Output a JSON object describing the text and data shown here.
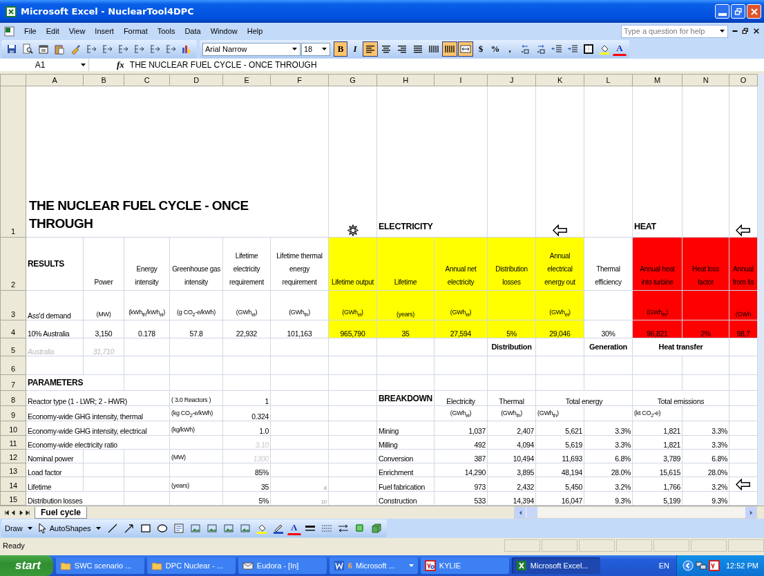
{
  "window": {
    "title": "Microsoft Excel - NuclearTool4DPC"
  },
  "menu": {
    "items": [
      "File",
      "Edit",
      "View",
      "Insert",
      "Format",
      "Tools",
      "Data",
      "Window",
      "Help"
    ],
    "help_search": {
      "placeholder": "Type a question for help"
    }
  },
  "toolbar": {
    "standard": [
      {
        "kind": "save"
      },
      {
        "kind": "preview"
      },
      {
        "kind": "calendar"
      },
      {
        "kind": "paste"
      },
      {
        "kind": "brush"
      },
      {
        "kind": "outline"
      },
      {
        "kind": "outline"
      },
      {
        "kind": "outline"
      },
      {
        "kind": "outline"
      },
      {
        "kind": "outline"
      },
      {
        "kind": "outline"
      },
      {
        "kind": "chart"
      }
    ],
    "font": "Arial Narrow",
    "size": "18",
    "format": [
      {
        "kind": "bold",
        "label": "B",
        "on": true
      },
      {
        "kind": "italic",
        "label": "I",
        "on": false
      },
      {
        "kind": "align-left",
        "on": true
      },
      {
        "kind": "align-center",
        "on": false
      },
      {
        "kind": "align-right",
        "on": false
      },
      {
        "kind": "justify",
        "on": false
      },
      {
        "kind": "distribute",
        "on": false
      },
      {
        "kind": "columns",
        "on": true
      },
      {
        "kind": "merge",
        "on": true
      },
      {
        "kind": "glyph",
        "label": "$",
        "on": false
      },
      {
        "kind": "glyph",
        "label": "%",
        "on": false
      },
      {
        "kind": "glyph",
        "label": ",",
        "on": false
      },
      {
        "kind": "decimal-more",
        "on": false
      },
      {
        "kind": "decimal-less",
        "on": false
      },
      {
        "kind": "outdent",
        "on": false
      },
      {
        "kind": "indent",
        "on": false
      },
      {
        "kind": "borders",
        "on": false
      },
      {
        "kind": "fill-color",
        "on": false
      },
      {
        "kind": "font-color",
        "label": "A",
        "on": false
      }
    ]
  },
  "formula_bar": {
    "cell": "A1",
    "function_label": "fx",
    "formula": "THE NUCLEAR FUEL CYCLE - ONCE THROUGH"
  },
  "sheet": {
    "columns": [
      "A",
      "B",
      "C",
      "D",
      "E",
      "F",
      "G",
      "H",
      "I",
      "J",
      "K",
      "L",
      "M",
      "N",
      "O"
    ],
    "rows": [
      {
        "number": "1",
        "cells": [
          {
            "kind": "title",
            "text": "THE NUCLEAR FUEL CYCLE - ONCE THROUGH",
            "colspan": 6
          },
          {
            "kind": "sun"
          },
          {
            "kind": "section",
            "text": "ELECTRICITY",
            "colspan": 2
          },
          {
            "kind": "empty"
          },
          {
            "kind": "arrow"
          },
          {
            "kind": "empty"
          },
          {
            "kind": "section",
            "text": "HEAT"
          },
          {
            "kind": "empty"
          },
          {
            "kind": "arrow"
          }
        ]
      },
      {
        "number": "2",
        "cells": [
          {
            "kind": "heading",
            "text": "RESULTS"
          },
          {
            "kind": "header",
            "text": "Power"
          },
          {
            "kind": "header",
            "text": "Energy intensity"
          },
          {
            "kind": "header",
            "text": "Greenhouse gas intensity"
          },
          {
            "kind": "header",
            "text": "Lifetime electricity requirement"
          },
          {
            "kind": "header",
            "text": "Lifetime thermal energy requirement"
          },
          {
            "kind": "header",
            "text": "Lifetime output",
            "color": "#ffff00"
          },
          {
            "kind": "header",
            "text": "Lifetime",
            "color": "#ffff00"
          },
          {
            "kind": "header",
            "text": "Annual net electricity",
            "color": "#ffff00"
          },
          {
            "kind": "header",
            "text": "Distribution losses",
            "color": "#ffff00"
          },
          {
            "kind": "header",
            "text": "Annual electrical energy out",
            "color": "#ffff00"
          },
          {
            "kind": "header",
            "text": "Thermal efficiency"
          },
          {
            "kind": "header",
            "text": "Annual heat into turbine",
            "color": "#ff0000"
          },
          {
            "kind": "header",
            "text": "Heat loss factor",
            "color": "#ff0000"
          },
          {
            "kind": "header",
            "text": "Annual from fis",
            "color": "#ff0000"
          }
        ]
      },
      {
        "number": "3",
        "cells": [
          {
            "kind": "label",
            "text": "Ass'd demand"
          },
          {
            "kind": "unit",
            "text": "(MW)"
          },
          {
            "kind": "unit",
            "text": "(kWh$_{th}$/kWh$_{el}$)"
          },
          {
            "kind": "unit",
            "text": "(g CO$_{2}$-e/kWh)"
          },
          {
            "kind": "unit",
            "text": "(GWh$_{el}$)"
          },
          {
            "kind": "unit",
            "text": "(GWh$_{th}$)"
          },
          {
            "kind": "unit",
            "text": "(GWh$_{el}$)",
            "color": "#ffff00"
          },
          {
            "kind": "unit",
            "text": "(years)",
            "color": "#ffff00"
          },
          {
            "kind": "unit",
            "text": "(GWh$_{el}$)",
            "color": "#ffff00"
          },
          {
            "kind": "empty",
            "color": "#ffff00"
          },
          {
            "kind": "unit",
            "text": "(GWh$_{el}$)",
            "color": "#ffff00"
          },
          {
            "kind": "empty"
          },
          {
            "kind": "unit",
            "text": "(GWh$_{th}$)",
            "color": "#ff0000"
          },
          {
            "kind": "empty",
            "color": "#ff0000"
          },
          {
            "kind": "unit",
            "text": "(GWh",
            "color": "#ff0000"
          }
        ]
      },
      {
        "number": "4",
        "cells": [
          {
            "kind": "label",
            "text": "10% Australia"
          },
          {
            "kind": "centered",
            "text": "3,150"
          },
          {
            "kind": "centered",
            "text": "0.178"
          },
          {
            "kind": "centered",
            "text": "57.8"
          },
          {
            "kind": "centered",
            "text": "22,932"
          },
          {
            "kind": "centered",
            "text": "101,163"
          },
          {
            "kind": "centered",
            "text": "965,790",
            "color": "#ffff00"
          },
          {
            "kind": "centered",
            "text": "35",
            "color": "#ffff00"
          },
          {
            "kind": "centered",
            "text": "27,594",
            "color": "#ffff00"
          },
          {
            "kind": "centered",
            "text": "5%",
            "color": "#ffff00"
          },
          {
            "kind": "centered",
            "text": "29,046",
            "color": "#ffff00"
          },
          {
            "kind": "centered",
            "text": "30%"
          },
          {
            "kind": "centered",
            "text": "96,821",
            "color": "#ff0000"
          },
          {
            "kind": "centered",
            "text": "2%",
            "color": "#ff0000"
          },
          {
            "kind": "centered",
            "text": "98,7",
            "color": "#ff0000"
          }
        ]
      },
      {
        "number": "5",
        "cells": [
          {
            "kind": "muted",
            "text": "Australia"
          },
          {
            "kind": "muted-center",
            "text": "31,710"
          },
          {
            "kind": "empty"
          },
          {
            "kind": "empty"
          },
          {
            "kind": "empty"
          },
          {
            "kind": "empty"
          },
          {
            "kind": "empty"
          },
          {
            "kind": "empty"
          },
          {
            "kind": "empty"
          },
          {
            "kind": "group",
            "text": "Distribution"
          },
          {
            "kind": "empty"
          },
          {
            "kind": "group",
            "text": "Generation"
          },
          {
            "kind": "group",
            "text": "Heat transfer",
            "colspan": 2
          }
        ]
      },
      {
        "number": "6",
        "cells": []
      },
      {
        "number": "7",
        "cells": [
          {
            "kind": "heading",
            "text": "PARAMETERS",
            "colspan": 2
          }
        ]
      },
      {
        "number": "8",
        "cells": [
          {
            "kind": "label",
            "text": "Reactor type (1 - LWR; 2 - HWR)",
            "colspan": 3
          },
          {
            "kind": "unit-left",
            "text": "( 3.0 Reactors )"
          },
          {
            "kind": "number",
            "text": "1"
          },
          {
            "kind": "empty"
          },
          {
            "kind": "empty"
          },
          {
            "kind": "heading",
            "text": "BREAKDOWN"
          },
          {
            "kind": "centered",
            "text": "Electricity"
          },
          {
            "kind": "centered",
            "text": "Thermal"
          },
          {
            "kind": "centered",
            "text": "Total energy",
            "colspan": 2
          },
          {
            "kind": "centered",
            "text": "Total emissions",
            "colspan": 2
          }
        ]
      },
      {
        "number": "9",
        "cells": [
          {
            "kind": "label",
            "text": "Economy-wide GHG intensity, thermal",
            "colspan": 3
          },
          {
            "kind": "unit-left",
            "text": "(kg CO$_{2}$-e/kWh)"
          },
          {
            "kind": "number",
            "text": "0.324"
          },
          {
            "kind": "empty"
          },
          {
            "kind": "empty"
          },
          {
            "kind": "empty"
          },
          {
            "kind": "unit",
            "text": "(GWh$_{el}$)"
          },
          {
            "kind": "unit",
            "text": "(GWh$_{th}$)"
          },
          {
            "kind": "unit-left",
            "text": "(GWh$_{th}$)"
          },
          {
            "kind": "empty"
          },
          {
            "kind": "unit-left",
            "text": "(kt CO$_{2}$-e)"
          }
        ]
      },
      {
        "number": "10",
        "cells": [
          {
            "kind": "label",
            "text": "Economy-wide GHG intensity, electrical",
            "colspan": 3
          },
          {
            "kind": "unit-left",
            "text": "(kg/kWh)"
          },
          {
            "kind": "number",
            "text": "1.0"
          },
          {
            "kind": "empty"
          },
          {
            "kind": "empty"
          },
          {
            "kind": "label",
            "text": "Mining"
          },
          {
            "kind": "number",
            "text": "1,037"
          },
          {
            "kind": "number",
            "text": "2,407"
          },
          {
            "kind": "number",
            "text": "5,621"
          },
          {
            "kind": "number",
            "text": "3.3%"
          },
          {
            "kind": "number",
            "text": "1,821"
          },
          {
            "kind": "number",
            "text": "3.3%"
          }
        ]
      },
      {
        "number": "11",
        "cells": [
          {
            "kind": "label",
            "text": "Economy-wide electricity ratio",
            "colspan": 3
          },
          {
            "kind": "empty"
          },
          {
            "kind": "muted-number",
            "text": "3.10"
          },
          {
            "kind": "empty"
          },
          {
            "kind": "empty"
          },
          {
            "kind": "label",
            "text": "Milling"
          },
          {
            "kind": "number",
            "text": "492"
          },
          {
            "kind": "number",
            "text": "4,094"
          },
          {
            "kind": "number",
            "text": "5,619"
          },
          {
            "kind": "number",
            "text": "3.3%"
          },
          {
            "kind": "number",
            "text": "1,821"
          },
          {
            "kind": "number",
            "text": "3.3%"
          }
        ]
      },
      {
        "number": "12",
        "cells": [
          {
            "kind": "label",
            "text": "Nominal power"
          },
          {
            "kind": "empty"
          },
          {
            "kind": "empty"
          },
          {
            "kind": "unit-left",
            "text": "(MW)"
          },
          {
            "kind": "muted-number",
            "text": "1300"
          },
          {
            "kind": "empty"
          },
          {
            "kind": "empty"
          },
          {
            "kind": "label",
            "text": "Conversion"
          },
          {
            "kind": "number",
            "text": "387"
          },
          {
            "kind": "number",
            "text": "10,494"
          },
          {
            "kind": "number",
            "text": "11,693"
          },
          {
            "kind": "number",
            "text": "6.8%"
          },
          {
            "kind": "number",
            "text": "3,789"
          },
          {
            "kind": "number",
            "text": "6.8%"
          }
        ]
      },
      {
        "number": "13",
        "cells": [
          {
            "kind": "label",
            "text": "Load factor"
          },
          {
            "kind": "empty"
          },
          {
            "kind": "empty"
          },
          {
            "kind": "empty"
          },
          {
            "kind": "number",
            "text": "85%"
          },
          {
            "kind": "empty"
          },
          {
            "kind": "empty"
          },
          {
            "kind": "label",
            "text": "Enrichment"
          },
          {
            "kind": "number",
            "text": "14,290"
          },
          {
            "kind": "number",
            "text": "3,895"
          },
          {
            "kind": "number",
            "text": "48,194"
          },
          {
            "kind": "number",
            "text": "28.0%"
          },
          {
            "kind": "number",
            "text": "15,615"
          },
          {
            "kind": "number",
            "text": "28.0%"
          }
        ]
      },
      {
        "number": "14",
        "cells": [
          {
            "kind": "label",
            "text": "Lifetime"
          },
          {
            "kind": "empty"
          },
          {
            "kind": "empty"
          },
          {
            "kind": "unit-left",
            "text": "(years)"
          },
          {
            "kind": "number",
            "text": "35"
          },
          {
            "kind": "tiny",
            "text": "8"
          },
          {
            "kind": "empty"
          },
          {
            "kind": "label",
            "text": "Fuel fabrication"
          },
          {
            "kind": "number",
            "text": "973"
          },
          {
            "kind": "number",
            "text": "2,432"
          },
          {
            "kind": "number",
            "text": "5,450"
          },
          {
            "kind": "number",
            "text": "3.2%"
          },
          {
            "kind": "number",
            "text": "1,766"
          },
          {
            "kind": "number",
            "text": "3.2%"
          },
          {
            "kind": "arrow"
          }
        ]
      },
      {
        "number": "15",
        "cells": [
          {
            "kind": "label",
            "text": "Distribution losses",
            "colspan": 2
          },
          {
            "kind": "empty"
          },
          {
            "kind": "empty"
          },
          {
            "kind": "number",
            "text": "5%"
          },
          {
            "kind": "tiny",
            "text": "10"
          },
          {
            "kind": "empty"
          },
          {
            "kind": "label",
            "text": "Construction"
          },
          {
            "kind": "number",
            "text": "533"
          },
          {
            "kind": "number",
            "text": "14,394"
          },
          {
            "kind": "number",
            "text": "16,047"
          },
          {
            "kind": "number",
            "text": "9.3%"
          },
          {
            "kind": "number",
            "text": "5,199"
          },
          {
            "kind": "number",
            "text": "9.3%"
          }
        ]
      }
    ]
  },
  "sheet_tabs": [
    {
      "label": "Fuel cycle",
      "selected": true
    }
  ],
  "draw_toolbar": {
    "draw": "Draw",
    "autoshapes": "AutoShapes",
    "tools": [
      {
        "kind": "line"
      },
      {
        "kind": "arrow"
      },
      {
        "kind": "rectangle"
      },
      {
        "kind": "oval"
      },
      {
        "kind": "textbox"
      },
      {
        "kind": "picture"
      },
      {
        "kind": "picture"
      },
      {
        "kind": "picture"
      },
      {
        "kind": "picture"
      },
      {
        "kind": "fill-color"
      },
      {
        "kind": "line-color"
      },
      {
        "kind": "font-color",
        "label": "A"
      },
      {
        "kind": "line-style"
      },
      {
        "kind": "dash-style"
      },
      {
        "kind": "arrow-style"
      },
      {
        "kind": "shadow"
      },
      {
        "kind": "cube"
      }
    ]
  },
  "status_bar": {
    "text": "Ready"
  },
  "taskbar": {
    "start": "start",
    "tasks": [
      {
        "kind": "folder",
        "label": "SWC scenario ...",
        "selected": false,
        "menu": false
      },
      {
        "kind": "folder",
        "label": "DPC Nuclear - ...",
        "selected": false,
        "menu": false
      },
      {
        "kind": "mail",
        "label": "Eudora - [In]",
        "selected": false,
        "menu": false
      },
      {
        "kind": "document",
        "count": "6",
        "label": "Microsoft ...",
        "selected": false,
        "menu": true
      },
      {
        "kind": "app",
        "label": "KYLIE",
        "selected": false,
        "menu": false
      },
      {
        "kind": "sheet",
        "label": "Microsoft Excel...",
        "selected": true,
        "menu": false
      }
    ],
    "language": "EN",
    "clock": "12:52 PM"
  }
}
